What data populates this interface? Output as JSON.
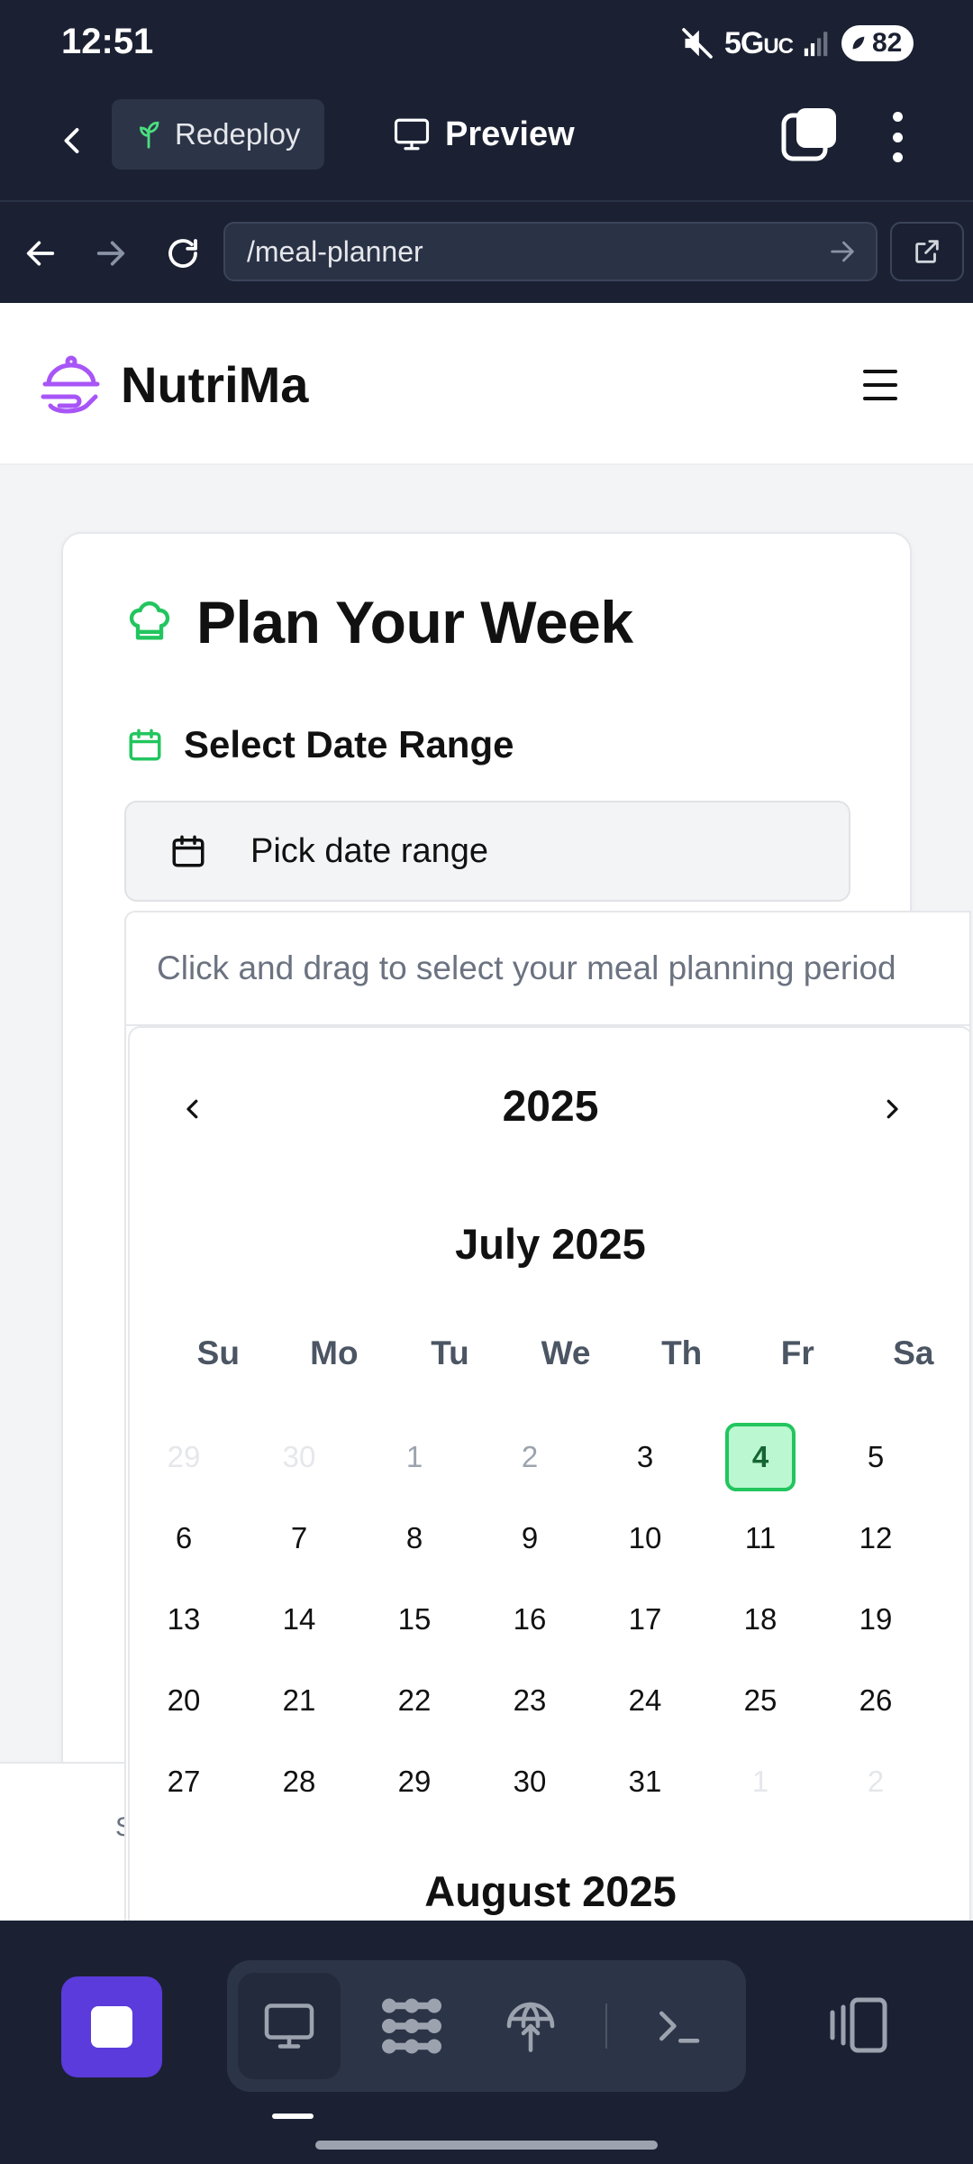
{
  "status_bar": {
    "time": "12:51",
    "network": "5G",
    "network_suffix": "UC",
    "battery": "82"
  },
  "app_toolbar": {
    "redeploy_label": "Redeploy",
    "preview_label": "Preview"
  },
  "url_bar": {
    "path": "/meal-planner"
  },
  "site": {
    "brand": "NutriMa",
    "accent_color": "#a855f7"
  },
  "card": {
    "title": "Plan Your Week",
    "section_label": "Select Date Range",
    "date_button_label": "Pick date range",
    "accent_color": "#22c55e"
  },
  "behind_text": "S",
  "popover": {
    "hint": "Click and drag to select your meal planning period",
    "year": "2025",
    "month": "July 2025",
    "next_month": "August 2025",
    "weekdays": [
      "Su",
      "Mo",
      "Tu",
      "We",
      "Th",
      "Fr",
      "Sa"
    ],
    "weeks": [
      [
        "29",
        "30",
        "1",
        "2",
        "3",
        "4",
        "5"
      ],
      [
        "6",
        "7",
        "8",
        "9",
        "10",
        "11",
        "12"
      ],
      [
        "13",
        "14",
        "15",
        "16",
        "17",
        "18",
        "19"
      ],
      [
        "20",
        "21",
        "22",
        "23",
        "24",
        "25",
        "26"
      ],
      [
        "27",
        "28",
        "29",
        "30",
        "31",
        "1",
        "2"
      ]
    ],
    "selected_day": "4"
  },
  "dock": {
    "accent_color": "#5b3bdb"
  }
}
